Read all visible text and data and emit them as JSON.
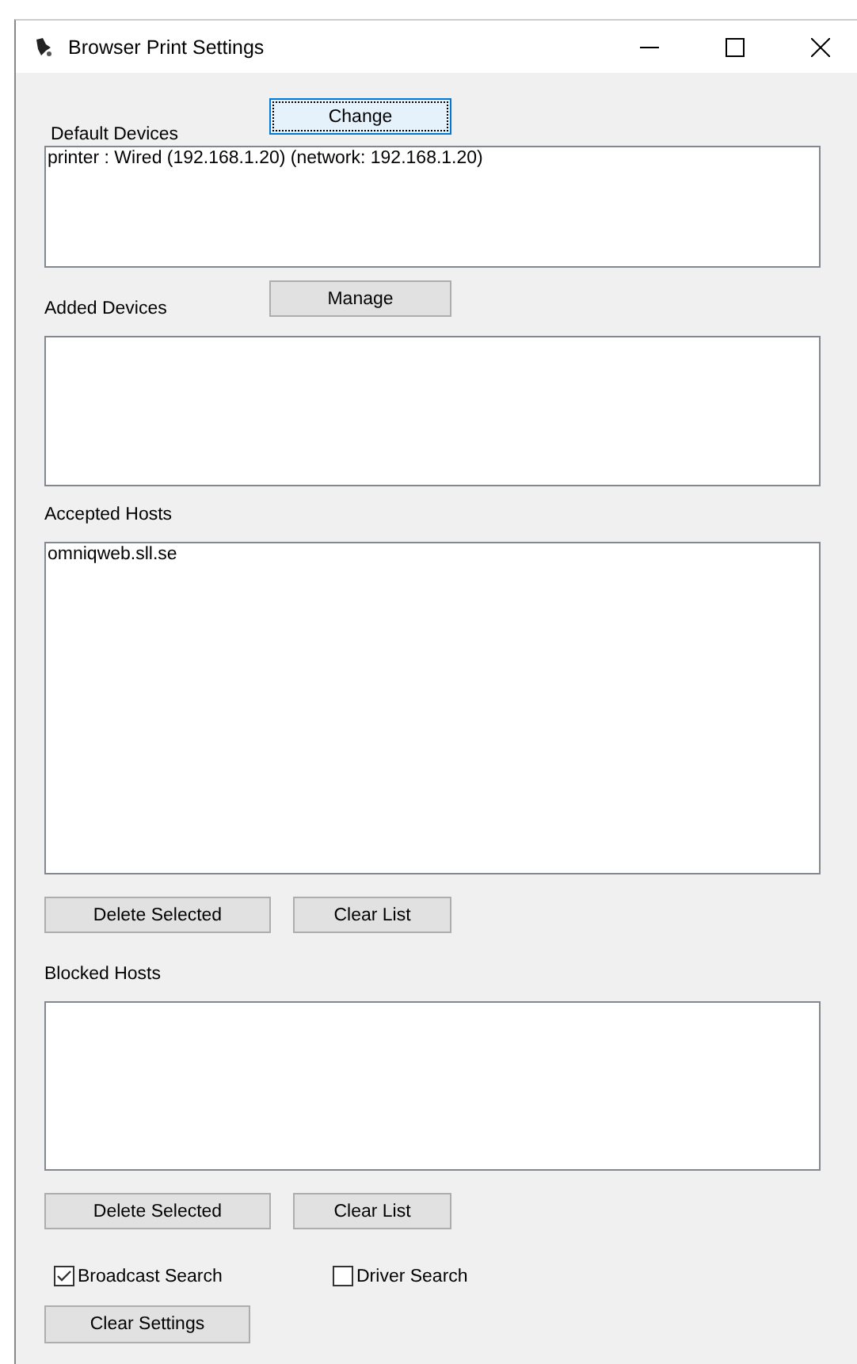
{
  "window": {
    "title": "Browser Print Settings"
  },
  "sections": [
    {
      "label": "Default Devices",
      "button": {
        "label": "Change",
        "focused": true
      },
      "items": [
        {
          "text": "printer : Wired (192.168.1.20) (network: 192.168.1.20)",
          "selected": false
        }
      ]
    },
    {
      "label": "Added Devices",
      "button": {
        "label": "Manage",
        "focused": false
      }
    },
    {
      "label": "Accepted Hosts",
      "items": [
        {
          "text": "omniqweb.sll.se",
          "selected": false
        }
      ],
      "actions": [
        "Delete Selected",
        "Clear List"
      ]
    },
    {
      "label": "Blocked Hosts",
      "actions": [
        "Delete Selected",
        "Clear List"
      ]
    }
  ],
  "checkboxes": [
    {
      "label": "Broadcast Search",
      "checked": true
    },
    {
      "label": "Driver Search",
      "checked": false
    }
  ],
  "footer_button": "Clear Settings"
}
